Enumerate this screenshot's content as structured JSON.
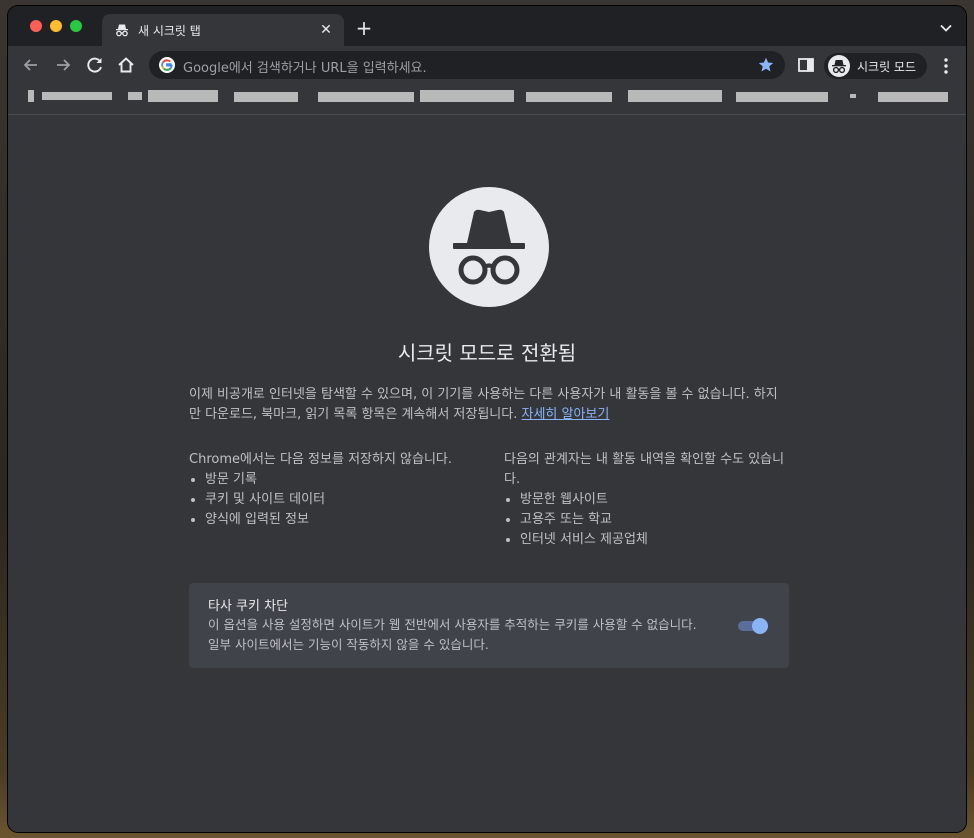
{
  "browser": {
    "tab": {
      "title": "새 시크릿 탭",
      "close_glyph": "✕"
    },
    "new_tab_glyph": "+",
    "omnibox": {
      "placeholder": "Google에서 검색하거나 URL을 입력하세요."
    },
    "profile_chip": {
      "label": "시크릿 모드"
    }
  },
  "colors": {
    "frame": "#202124",
    "surface": "#35363a",
    "card": "#41434a",
    "text_primary": "#e8eaed",
    "text_secondary": "#bdc1c6",
    "link": "#8ab4f8",
    "toggle_on": "#8ab4f8"
  },
  "page": {
    "heading": "시크릿 모드로 전환됨",
    "intro": "이제 비공개로 인터넷을 탐색할 수 있으며, 이 기기를 사용하는 다른 사용자가 내 활동을 볼 수 없습니다. 하지만 다운로드, 북마크, 읽기 목록 항목은 계속해서 저장됩니다. ",
    "learn_more": "자세히 알아보기",
    "not_saved": {
      "title": "Chrome에서는 다음 정보를 저장하지 않습니다.",
      "items": [
        "방문 기록",
        "쿠키 및 사이트 데이터",
        "양식에 입력된 정보"
      ]
    },
    "visible_to": {
      "title": "다음의 관계자는 내 활동 내역을 확인할 수도 있습니다.",
      "items": [
        "방문한 웹사이트",
        "고용주 또는 학교",
        "인터넷 서비스 제공업체"
      ]
    },
    "cookie_card": {
      "title": "타사 쿠키 차단",
      "line1": "이 옵션을 사용 설정하면 사이트가 웹 전반에서 사용자를 추적하는 쿠키를 사용할 수 없습니다.",
      "line2": "일부 사이트에서는 기능이 작동하지 않을 수 있습니다.",
      "enabled": true
    }
  }
}
